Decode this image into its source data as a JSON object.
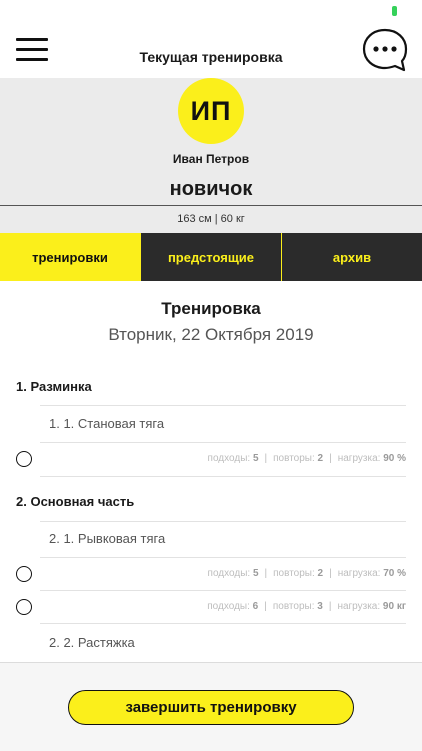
{
  "header": {
    "title": "Текущая тренировка",
    "menu_icon": "hamburger-menu-icon",
    "chat_icon": "chat-bubble-icon"
  },
  "profile": {
    "initials": "ИП",
    "name": "Иван Петров",
    "level": "новичок",
    "stats": "163 см | 60 кг"
  },
  "tabs": [
    {
      "label": "тренировки",
      "active": true
    },
    {
      "label": "предстоящие",
      "active": false
    },
    {
      "label": "архив",
      "active": false
    }
  ],
  "workout": {
    "title": "Тренировка",
    "date": "Вторник, 22 Октября 2019",
    "sections": [
      {
        "title": "1. Разминка",
        "exercises": [
          {
            "name": "1. 1. Становая тяга",
            "sets": [
              {
                "approaches_label": "подходы:",
                "approaches": "5",
                "reps_label": "повторы:",
                "reps": "2",
                "load_label": "нагрузка:",
                "load": "90 %",
                "done": false
              }
            ]
          }
        ]
      },
      {
        "title": "2. Основная часть",
        "exercises": [
          {
            "name": "2. 1. Рывковая тяга",
            "sets": [
              {
                "approaches_label": "подходы:",
                "approaches": "5",
                "reps_label": "повторы:",
                "reps": "2",
                "load_label": "нагрузка:",
                "load": "70 %",
                "done": false
              },
              {
                "approaches_label": "подходы:",
                "approaches": "6",
                "reps_label": "повторы:",
                "reps": "3",
                "load_label": "нагрузка:",
                "load": "90 кг",
                "done": false
              }
            ]
          },
          {
            "name": "2. 2. Растяжка",
            "sets": []
          }
        ]
      }
    ]
  },
  "footer": {
    "finish_label": "завершить тренировку"
  },
  "colors": {
    "accent": "#fbef1b",
    "dark": "#2b2b2b",
    "status": "#35d15a"
  }
}
